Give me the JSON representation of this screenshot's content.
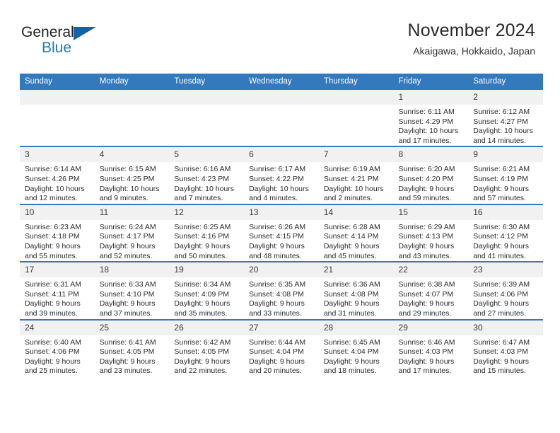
{
  "brand": {
    "name_part1": "General",
    "name_part2": "Blue",
    "triangle_color": "#1264a8",
    "blue_color": "#1f7ac4"
  },
  "header": {
    "title": "November 2024",
    "subtitle": "Akaigawa, Hokkaido, Japan",
    "accent_color": "#3279bd",
    "daynum_strip_color": "#f1f1f1"
  },
  "weekdays": [
    "Sunday",
    "Monday",
    "Tuesday",
    "Wednesday",
    "Thursday",
    "Friday",
    "Saturday"
  ],
  "weeks": [
    [
      {
        "day": "",
        "info": ""
      },
      {
        "day": "",
        "info": ""
      },
      {
        "day": "",
        "info": ""
      },
      {
        "day": "",
        "info": ""
      },
      {
        "day": "",
        "info": ""
      },
      {
        "day": "1",
        "info": "Sunrise: 6:11 AM\nSunset: 4:29 PM\nDaylight: 10 hours and 17 minutes."
      },
      {
        "day": "2",
        "info": "Sunrise: 6:12 AM\nSunset: 4:27 PM\nDaylight: 10 hours and 14 minutes."
      }
    ],
    [
      {
        "day": "3",
        "info": "Sunrise: 6:14 AM\nSunset: 4:26 PM\nDaylight: 10 hours and 12 minutes."
      },
      {
        "day": "4",
        "info": "Sunrise: 6:15 AM\nSunset: 4:25 PM\nDaylight: 10 hours and 9 minutes."
      },
      {
        "day": "5",
        "info": "Sunrise: 6:16 AM\nSunset: 4:23 PM\nDaylight: 10 hours and 7 minutes."
      },
      {
        "day": "6",
        "info": "Sunrise: 6:17 AM\nSunset: 4:22 PM\nDaylight: 10 hours and 4 minutes."
      },
      {
        "day": "7",
        "info": "Sunrise: 6:19 AM\nSunset: 4:21 PM\nDaylight: 10 hours and 2 minutes."
      },
      {
        "day": "8",
        "info": "Sunrise: 6:20 AM\nSunset: 4:20 PM\nDaylight: 9 hours and 59 minutes."
      },
      {
        "day": "9",
        "info": "Sunrise: 6:21 AM\nSunset: 4:19 PM\nDaylight: 9 hours and 57 minutes."
      }
    ],
    [
      {
        "day": "10",
        "info": "Sunrise: 6:23 AM\nSunset: 4:18 PM\nDaylight: 9 hours and 55 minutes."
      },
      {
        "day": "11",
        "info": "Sunrise: 6:24 AM\nSunset: 4:17 PM\nDaylight: 9 hours and 52 minutes."
      },
      {
        "day": "12",
        "info": "Sunrise: 6:25 AM\nSunset: 4:16 PM\nDaylight: 9 hours and 50 minutes."
      },
      {
        "day": "13",
        "info": "Sunrise: 6:26 AM\nSunset: 4:15 PM\nDaylight: 9 hours and 48 minutes."
      },
      {
        "day": "14",
        "info": "Sunrise: 6:28 AM\nSunset: 4:14 PM\nDaylight: 9 hours and 45 minutes."
      },
      {
        "day": "15",
        "info": "Sunrise: 6:29 AM\nSunset: 4:13 PM\nDaylight: 9 hours and 43 minutes."
      },
      {
        "day": "16",
        "info": "Sunrise: 6:30 AM\nSunset: 4:12 PM\nDaylight: 9 hours and 41 minutes."
      }
    ],
    [
      {
        "day": "17",
        "info": "Sunrise: 6:31 AM\nSunset: 4:11 PM\nDaylight: 9 hours and 39 minutes."
      },
      {
        "day": "18",
        "info": "Sunrise: 6:33 AM\nSunset: 4:10 PM\nDaylight: 9 hours and 37 minutes."
      },
      {
        "day": "19",
        "info": "Sunrise: 6:34 AM\nSunset: 4:09 PM\nDaylight: 9 hours and 35 minutes."
      },
      {
        "day": "20",
        "info": "Sunrise: 6:35 AM\nSunset: 4:08 PM\nDaylight: 9 hours and 33 minutes."
      },
      {
        "day": "21",
        "info": "Sunrise: 6:36 AM\nSunset: 4:08 PM\nDaylight: 9 hours and 31 minutes."
      },
      {
        "day": "22",
        "info": "Sunrise: 6:38 AM\nSunset: 4:07 PM\nDaylight: 9 hours and 29 minutes."
      },
      {
        "day": "23",
        "info": "Sunrise: 6:39 AM\nSunset: 4:06 PM\nDaylight: 9 hours and 27 minutes."
      }
    ],
    [
      {
        "day": "24",
        "info": "Sunrise: 6:40 AM\nSunset: 4:06 PM\nDaylight: 9 hours and 25 minutes."
      },
      {
        "day": "25",
        "info": "Sunrise: 6:41 AM\nSunset: 4:05 PM\nDaylight: 9 hours and 23 minutes."
      },
      {
        "day": "26",
        "info": "Sunrise: 6:42 AM\nSunset: 4:05 PM\nDaylight: 9 hours and 22 minutes."
      },
      {
        "day": "27",
        "info": "Sunrise: 6:44 AM\nSunset: 4:04 PM\nDaylight: 9 hours and 20 minutes."
      },
      {
        "day": "28",
        "info": "Sunrise: 6:45 AM\nSunset: 4:04 PM\nDaylight: 9 hours and 18 minutes."
      },
      {
        "day": "29",
        "info": "Sunrise: 6:46 AM\nSunset: 4:03 PM\nDaylight: 9 hours and 17 minutes."
      },
      {
        "day": "30",
        "info": "Sunrise: 6:47 AM\nSunset: 4:03 PM\nDaylight: 9 hours and 15 minutes."
      }
    ]
  ]
}
